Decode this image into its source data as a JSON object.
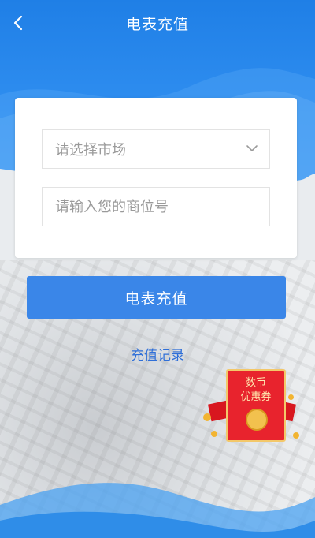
{
  "header": {
    "title": "电表充值",
    "back_icon": "chevron-left-icon"
  },
  "form": {
    "market_select": {
      "placeholder": "请选择市场",
      "icon": "chevron-down-icon"
    },
    "booth_input": {
      "placeholder": "请输入您的商位号",
      "value": ""
    }
  },
  "actions": {
    "submit_label": "电表充值",
    "record_link": "充值记录"
  },
  "coupon": {
    "line1": "数币",
    "line2": "优惠券"
  },
  "colors": {
    "header_blue": "#1f7fe6",
    "button_blue": "#3a86e8",
    "link_blue": "#2f6fd8",
    "coupon_red": "#e8232d"
  }
}
